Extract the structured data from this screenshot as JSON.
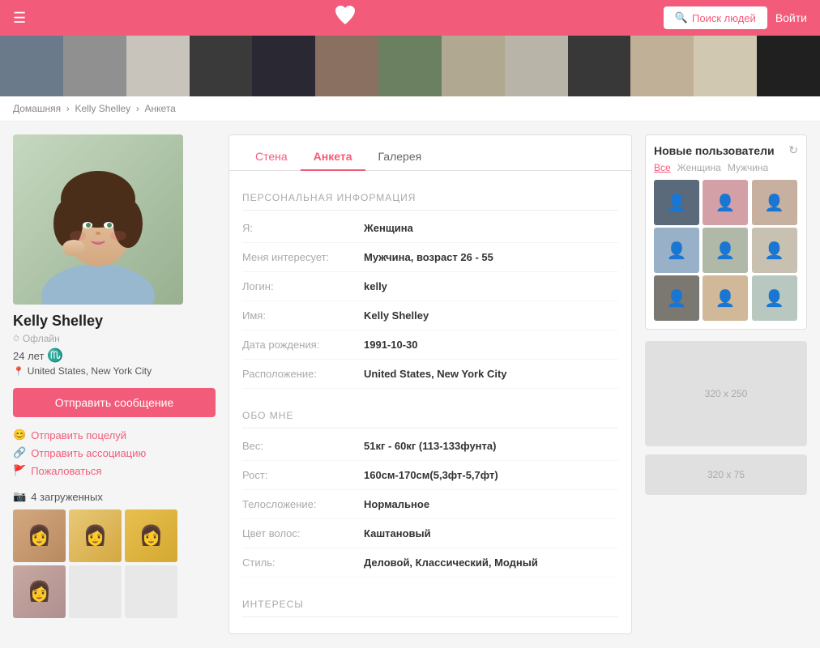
{
  "header": {
    "search_btn": "Поиск людей",
    "login_btn": "Войти",
    "heart": "♥"
  },
  "breadcrumb": {
    "home": "Домашняя",
    "name": "Kelly Shelley",
    "page": "Анкета"
  },
  "profile": {
    "name": "Kelly Shelley",
    "status": "Офлайн",
    "age": "24 лет",
    "zodiac": "♏",
    "location": "United States, New York City",
    "btn_message": "Отправить сообщение",
    "action_kiss": "Отправить поцелуй",
    "action_assoc": "Отправить ассоциацию",
    "action_report": "Пожаловаться",
    "photos_label": "4 загруженных"
  },
  "tabs": {
    "wall": "Стена",
    "profile": "Анкета",
    "gallery": "Галерея"
  },
  "personal_section": "ПЕРСОНАЛЬНАЯ ИНФОРМАЦИЯ",
  "info": [
    {
      "label": "Я:",
      "value": "Женщина"
    },
    {
      "label": "Меня интересует:",
      "value": "Мужчина, возраст 26 - 55"
    },
    {
      "label": "Логин:",
      "value": "kelly"
    },
    {
      "label": "Имя:",
      "value": "Kelly Shelley"
    },
    {
      "label": "Дата рождения:",
      "value": "1991-10-30"
    },
    {
      "label": "Расположение:",
      "value": "United States, New York City"
    }
  ],
  "about_section": "ОБО МНЕ",
  "about": [
    {
      "label": "Вес:",
      "value": "51кг - 60кг (113-133фунта)"
    },
    {
      "label": "Рост:",
      "value": "160см-170см(5,3фт-5,7фт)"
    },
    {
      "label": "Телосложение:",
      "value": "Нормальное"
    },
    {
      "label": "Цвет волос:",
      "value": "Каштановый"
    },
    {
      "label": "Стиль:",
      "value": "Деловой, Классический, Модный"
    }
  ],
  "interests_section": "ИНТЕРЕСЫ",
  "new_users": {
    "title": "Новые пользователи",
    "filter_all": "Все",
    "filter_female": "Женщина",
    "filter_male": "Мужчина"
  },
  "ads": {
    "large": "320 x 250",
    "small": "320 x 75"
  },
  "strip_colors": [
    "#7a8fa0",
    "#b0a090",
    "#c0c8b8",
    "#8090a0",
    "#a89880",
    "#bca898",
    "#909090",
    "#b8b090",
    "#a0b0a8",
    "#888090",
    "#b8a880",
    "#c0b0a0",
    "#909898"
  ]
}
